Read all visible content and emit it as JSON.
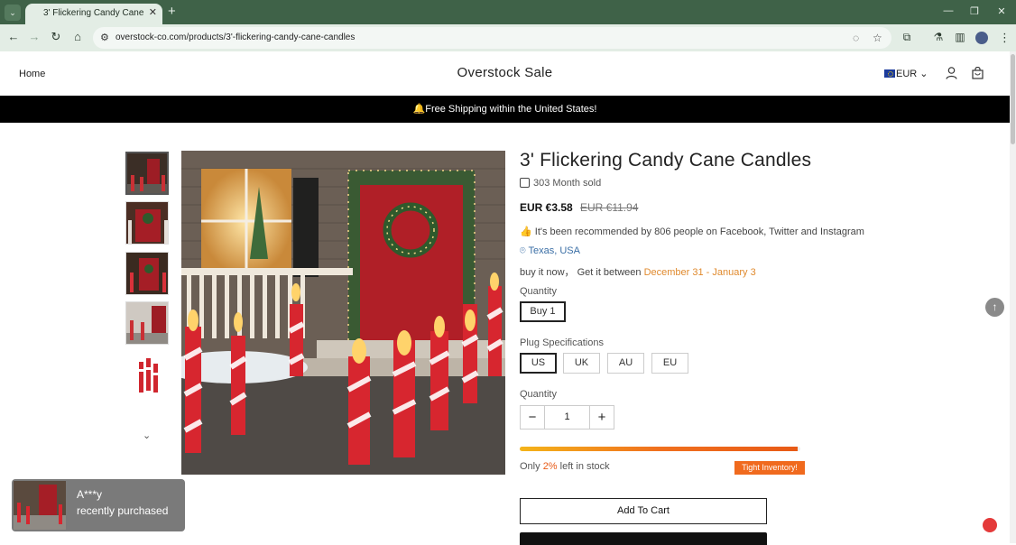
{
  "browser": {
    "tab_title": "3' Flickering Candy Cane Candles",
    "url": "overstock-co.com/products/3'-flickering-candy-cane-candles"
  },
  "header": {
    "home_label": "Home",
    "brand": "Overstock Sale",
    "currency": "EUR"
  },
  "announcement": "🔔Free Shipping within the United States!",
  "product": {
    "title": "3' Flickering Candy Cane Candles",
    "sold": "303 Month sold",
    "price": "EUR €3.58",
    "compare_price": "EUR €11.94",
    "recommend": "It's been recommended by 806 people on Facebook, Twitter and Instagram",
    "location": "Texas, USA",
    "delivery_prefix": "buy it now， Get it between",
    "delivery_dates": "December 31 - January 3",
    "quantity_option_label": "Quantity",
    "quantity_options": [
      "Buy 1"
    ],
    "plug_label": "Plug Specifications",
    "plug_options": [
      "US",
      "UK",
      "AU",
      "EU"
    ],
    "plug_selected": "US",
    "quantity_label": "Quantity",
    "quantity_value": "1",
    "stock_prefix": "Only",
    "stock_percent": "2%",
    "stock_suffix": "left in stock",
    "stock_fill_fraction": 0.99,
    "tight_badge": "Tight Inventory!",
    "add_to_cart": "Add To Cart"
  },
  "toast": {
    "name": "A***y",
    "message": "recently purchased"
  }
}
